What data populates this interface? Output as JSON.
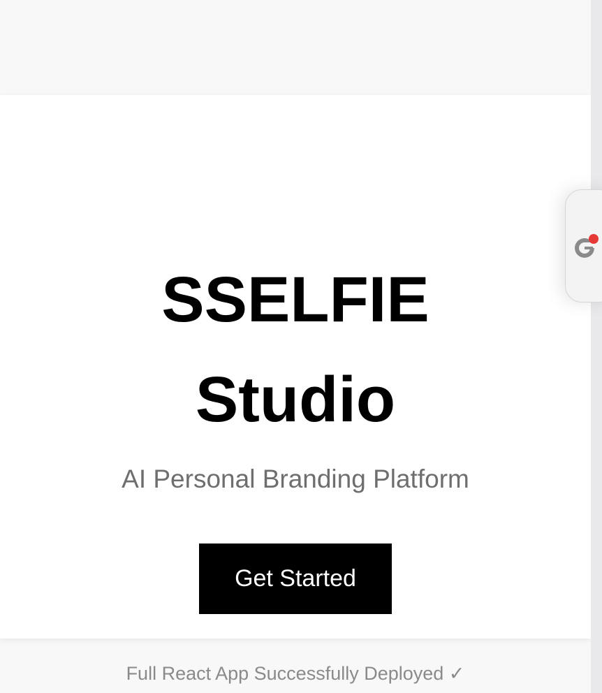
{
  "hero": {
    "title_line1": "SSELFIE",
    "title_line2": "Studio",
    "subtitle": "AI Personal Branding Platform",
    "cta_label": "Get Started",
    "status_text": "Full React App Successfully Deployed ✓"
  },
  "extension": {
    "icon": "grammarly-icon",
    "badge_color": "#e53935"
  },
  "colors": {
    "page_background": "#f8f8f9",
    "card_background": "#ffffff",
    "title_color": "#000000",
    "subtitle_color": "#6e6e6e",
    "status_color": "#8a8a8a",
    "button_background": "#000000",
    "button_text": "#ffffff"
  }
}
